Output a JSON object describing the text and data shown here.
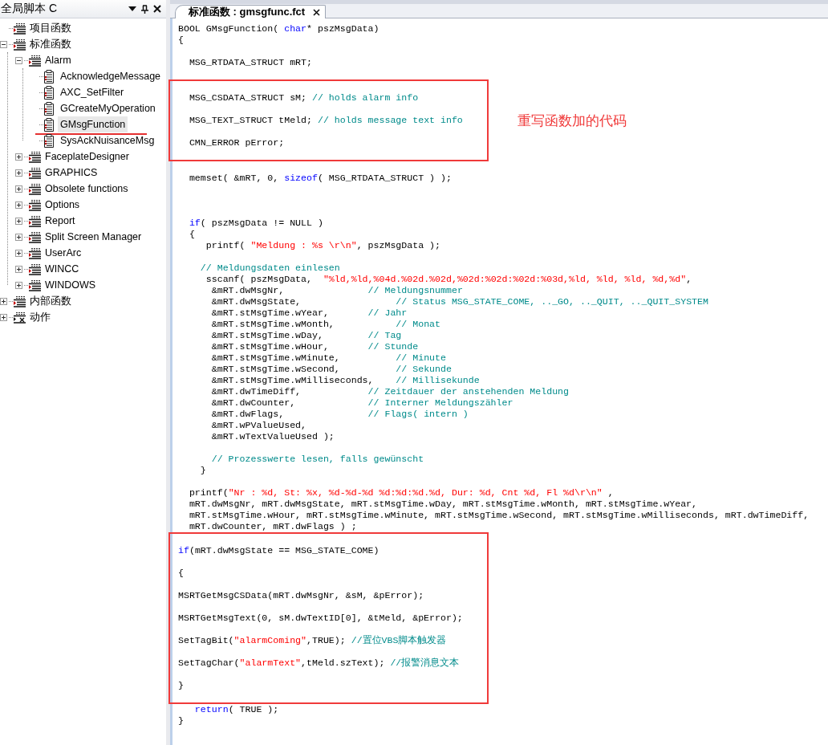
{
  "script_panel": {
    "title": "全局脚本 C",
    "tree": [
      {
        "label": "项目函数",
        "kind": "plain-group",
        "selected": false,
        "underlined": false
      },
      {
        "label": "标准函数",
        "kind": "group",
        "expanded": true,
        "selected": false,
        "underlined": false,
        "children": [
          {
            "label": "Alarm",
            "kind": "group",
            "expanded": true,
            "selected": false,
            "underlined": false,
            "children": [
              {
                "label": "AcknowledgeMessage",
                "kind": "function",
                "selected": false,
                "underlined": false
              },
              {
                "label": "AXC_SetFilter",
                "kind": "function",
                "selected": false,
                "underlined": false
              },
              {
                "label": "GCreateMyOperation",
                "kind": "function",
                "selected": false,
                "underlined": false
              },
              {
                "label": "GMsgFunction",
                "kind": "function",
                "selected": true,
                "underlined": true
              },
              {
                "label": "SysAckNuisanceMsg",
                "kind": "function",
                "selected": false,
                "underlined": false
              }
            ]
          },
          {
            "label": "FaceplateDesigner",
            "kind": "group",
            "expanded": false,
            "selected": false,
            "underlined": false
          },
          {
            "label": "GRAPHICS",
            "kind": "group",
            "expanded": false,
            "selected": false,
            "underlined": false
          },
          {
            "label": "Obsolete functions",
            "kind": "group",
            "expanded": false,
            "selected": false,
            "underlined": false
          },
          {
            "label": "Options",
            "kind": "group",
            "expanded": false,
            "selected": false,
            "underlined": false
          },
          {
            "label": "Report",
            "kind": "group",
            "expanded": false,
            "selected": false,
            "underlined": false
          },
          {
            "label": "Split Screen Manager",
            "kind": "group",
            "expanded": false,
            "selected": false,
            "underlined": false
          },
          {
            "label": "UserArc",
            "kind": "group",
            "expanded": false,
            "selected": false,
            "underlined": false
          },
          {
            "label": "WINCC",
            "kind": "group",
            "expanded": false,
            "selected": false,
            "underlined": false
          },
          {
            "label": "WINDOWS",
            "kind": "group",
            "expanded": false,
            "selected": false,
            "underlined": false
          }
        ]
      },
      {
        "label": "内部函数",
        "kind": "group",
        "expanded": false,
        "selected": false,
        "underlined": false
      },
      {
        "label": "动作",
        "kind": "action-group",
        "expanded": false,
        "selected": false,
        "underlined": false
      }
    ]
  },
  "editor": {
    "tab": {
      "label": "标准函数 : gmsgfunc.fct",
      "selected": true
    },
    "sections": [
      {
        "highlighted": false,
        "lines": [
          {
            "kind": "code",
            "segments": [
              {
                "kind": "plain",
                "text": "BOOL GMsgFunction( "
              },
              {
                "kind": "keyword",
                "text": "char"
              },
              {
                "kind": "plain",
                "text": "* pszMsgData)"
              }
            ]
          },
          {
            "kind": "code",
            "segments": [
              {
                "kind": "plain",
                "text": "{"
              }
            ]
          },
          {
            "kind": "blank"
          },
          {
            "kind": "code",
            "segments": [
              {
                "kind": "plain",
                "text": "  MSG_RTDATA_STRUCT mRT;"
              }
            ]
          },
          {
            "kind": "blank"
          }
        ]
      },
      {
        "highlighted": true,
        "note": "重写函数加的代码",
        "lines": [
          {
            "kind": "blank"
          },
          {
            "kind": "code",
            "segments": [
              {
                "kind": "plain",
                "text": "  MSG_CSDATA_STRUCT sM; "
              },
              {
                "kind": "comment",
                "text": "// holds alarm info"
              }
            ]
          },
          {
            "kind": "blank"
          },
          {
            "kind": "code",
            "segments": [
              {
                "kind": "plain",
                "text": "  MSG_TEXT_STRUCT tMeld; "
              },
              {
                "kind": "comment",
                "text": "// holds message text info"
              }
            ]
          },
          {
            "kind": "blank"
          },
          {
            "kind": "code",
            "segments": [
              {
                "kind": "plain",
                "text": "  CMN_ERROR pError;"
              }
            ]
          },
          {
            "kind": "blank"
          }
        ]
      },
      {
        "highlighted": false,
        "lines": [
          {
            "kind": "blank"
          },
          {
            "kind": "code",
            "segments": [
              {
                "kind": "plain",
                "text": "  memset( &mRT, 0, "
              },
              {
                "kind": "keyword",
                "text": "sizeof"
              },
              {
                "kind": "plain",
                "text": "( MSG_RTDATA_STRUCT ) );"
              }
            ]
          },
          {
            "kind": "blank"
          },
          {
            "kind": "blank"
          },
          {
            "kind": "blank"
          },
          {
            "kind": "code",
            "segments": [
              {
                "kind": "keyword",
                "text": "  if"
              },
              {
                "kind": "plain",
                "text": "( pszMsgData != NULL )"
              }
            ]
          },
          {
            "kind": "code",
            "segments": [
              {
                "kind": "plain",
                "text": "  {"
              }
            ]
          },
          {
            "kind": "code",
            "segments": [
              {
                "kind": "plain",
                "text": "     printf( "
              },
              {
                "kind": "string",
                "text": "\"Meldung : %s \\r\\n\""
              },
              {
                "kind": "plain",
                "text": ", pszMsgData );"
              }
            ]
          },
          {
            "kind": "blank"
          },
          {
            "kind": "code",
            "segments": [
              {
                "kind": "comment",
                "text": "    // Meldungsdaten einlesen"
              }
            ]
          },
          {
            "kind": "code",
            "segments": [
              {
                "kind": "plain",
                "text": "     sscanf( pszMsgData,  "
              },
              {
                "kind": "string",
                "text": "\"%ld,%ld,%04d.%02d.%02d,%02d:%02d:%02d:%03d,%ld, %ld, %ld, %d,%d\""
              },
              {
                "kind": "plain",
                "text": ","
              }
            ]
          },
          {
            "kind": "code",
            "segments": [
              {
                "kind": "plain",
                "text": "      &mRT.dwMsgNr,               "
              },
              {
                "kind": "comment",
                "text": "// Meldungsnummer"
              }
            ]
          },
          {
            "kind": "code",
            "segments": [
              {
                "kind": "plain",
                "text": "      &mRT.dwMsgState,                 "
              },
              {
                "kind": "comment",
                "text": "// Status MSG_STATE_COME, .._GO, .._QUIT, .._QUIT_SYSTEM"
              }
            ]
          },
          {
            "kind": "code",
            "segments": [
              {
                "kind": "plain",
                "text": "      &mRT.stMsgTime.wYear,       "
              },
              {
                "kind": "comment",
                "text": "// Jahr"
              }
            ]
          },
          {
            "kind": "code",
            "segments": [
              {
                "kind": "plain",
                "text": "      &mRT.stMsgTime.wMonth,           "
              },
              {
                "kind": "comment",
                "text": "// Monat"
              }
            ]
          },
          {
            "kind": "code",
            "segments": [
              {
                "kind": "plain",
                "text": "      &mRT.stMsgTime.wDay,        "
              },
              {
                "kind": "comment",
                "text": "// Tag"
              }
            ]
          },
          {
            "kind": "code",
            "segments": [
              {
                "kind": "plain",
                "text": "      &mRT.stMsgTime.wHour,       "
              },
              {
                "kind": "comment",
                "text": "// Stunde"
              }
            ]
          },
          {
            "kind": "code",
            "segments": [
              {
                "kind": "plain",
                "text": "      &mRT.stMsgTime.wMinute,          "
              },
              {
                "kind": "comment",
                "text": "// Minute"
              }
            ]
          },
          {
            "kind": "code",
            "segments": [
              {
                "kind": "plain",
                "text": "      &mRT.stMsgTime.wSecond,          "
              },
              {
                "kind": "comment",
                "text": "// Sekunde"
              }
            ]
          },
          {
            "kind": "code",
            "segments": [
              {
                "kind": "plain",
                "text": "      &mRT.stMsgTime.wMilliseconds,    "
              },
              {
                "kind": "comment",
                "text": "// Millisekunde"
              }
            ]
          },
          {
            "kind": "code",
            "segments": [
              {
                "kind": "plain",
                "text": "      &mRT.dwTimeDiff,            "
              },
              {
                "kind": "comment",
                "text": "// Zeitdauer der anstehenden Meldung"
              }
            ]
          },
          {
            "kind": "code",
            "segments": [
              {
                "kind": "plain",
                "text": "      &mRT.dwCounter,             "
              },
              {
                "kind": "comment",
                "text": "// Interner Meldungszähler"
              }
            ]
          },
          {
            "kind": "code",
            "segments": [
              {
                "kind": "plain",
                "text": "      &mRT.dwFlags,               "
              },
              {
                "kind": "comment",
                "text": "// Flags( intern )"
              }
            ]
          },
          {
            "kind": "code",
            "segments": [
              {
                "kind": "plain",
                "text": "      &mRT.wPValueUsed,"
              }
            ]
          },
          {
            "kind": "code",
            "segments": [
              {
                "kind": "plain",
                "text": "      &mRT.wTextValueUsed );"
              }
            ]
          },
          {
            "kind": "blank"
          },
          {
            "kind": "code",
            "segments": [
              {
                "kind": "comment",
                "text": "      // Prozesswerte lesen, falls gewünscht"
              }
            ]
          },
          {
            "kind": "code",
            "segments": [
              {
                "kind": "plain",
                "text": "    }"
              }
            ]
          },
          {
            "kind": "blank"
          },
          {
            "kind": "code",
            "segments": [
              {
                "kind": "plain",
                "text": "  printf("
              },
              {
                "kind": "string",
                "text": "\"Nr : %d, St: %x, %d-%d-%d %d:%d:%d.%d, Dur: %d, Cnt %d, Fl %d\\r\\n\""
              },
              {
                "kind": "plain",
                "text": " ,"
              }
            ]
          },
          {
            "kind": "code",
            "segments": [
              {
                "kind": "plain",
                "text": "  mRT.dwMsgNr, mRT.dwMsgState, mRT.stMsgTime.wDay, mRT.stMsgTime.wMonth, mRT.stMsgTime.wYear,"
              }
            ]
          },
          {
            "kind": "code",
            "segments": [
              {
                "kind": "plain",
                "text": "  mRT.stMsgTime.wHour, mRT.stMsgTime.wMinute, mRT.stMsgTime.wSecond, mRT.stMsgTime.wMilliseconds, mRT.dwTimeDiff,"
              }
            ]
          },
          {
            "kind": "code",
            "segments": [
              {
                "kind": "plain",
                "text": "  mRT.dwCounter, mRT.dwFlags ) ;"
              }
            ]
          }
        ]
      },
      {
        "highlighted": true,
        "lines": [
          {
            "kind": "blank"
          },
          {
            "kind": "code",
            "segments": [
              {
                "kind": "keyword",
                "text": "if"
              },
              {
                "kind": "plain",
                "text": "(mRT.dwMsgState == MSG_STATE_COME)"
              }
            ]
          },
          {
            "kind": "blank"
          },
          {
            "kind": "code",
            "segments": [
              {
                "kind": "plain",
                "text": "{"
              }
            ]
          },
          {
            "kind": "blank"
          },
          {
            "kind": "code",
            "segments": [
              {
                "kind": "plain",
                "text": "MSRTGetMsgCSData(mRT.dwMsgNr, &sM, &pError);"
              }
            ]
          },
          {
            "kind": "blank"
          },
          {
            "kind": "code",
            "segments": [
              {
                "kind": "plain",
                "text": "MSRTGetMsgText(0, sM.dwTextID[0], &tMeld, &pError);"
              }
            ]
          },
          {
            "kind": "blank"
          },
          {
            "kind": "code",
            "segments": [
              {
                "kind": "plain",
                "text": "SetTagBit("
              },
              {
                "kind": "string",
                "text": "\"alarmComing\""
              },
              {
                "kind": "plain",
                "text": ",TRUE); "
              },
              {
                "kind": "comment",
                "text": "//置位VBS脚本触发器"
              }
            ]
          },
          {
            "kind": "blank"
          },
          {
            "kind": "code",
            "segments": [
              {
                "kind": "plain",
                "text": "SetTagChar("
              },
              {
                "kind": "string",
                "text": "\"alarmText\""
              },
              {
                "kind": "plain",
                "text": ",tMeld.szText); "
              },
              {
                "kind": "comment",
                "text": "//报警消息文本"
              }
            ]
          },
          {
            "kind": "blank"
          },
          {
            "kind": "code",
            "segments": [
              {
                "kind": "plain",
                "text": "}"
              }
            ]
          },
          {
            "kind": "blank"
          }
        ]
      },
      {
        "highlighted": false,
        "lines": [
          {
            "kind": "code",
            "segments": [
              {
                "kind": "keyword",
                "text": "   return"
              },
              {
                "kind": "plain",
                "text": "( TRUE );"
              }
            ]
          },
          {
            "kind": "code",
            "segments": [
              {
                "kind": "plain",
                "text": "}"
              }
            ]
          }
        ]
      }
    ]
  }
}
